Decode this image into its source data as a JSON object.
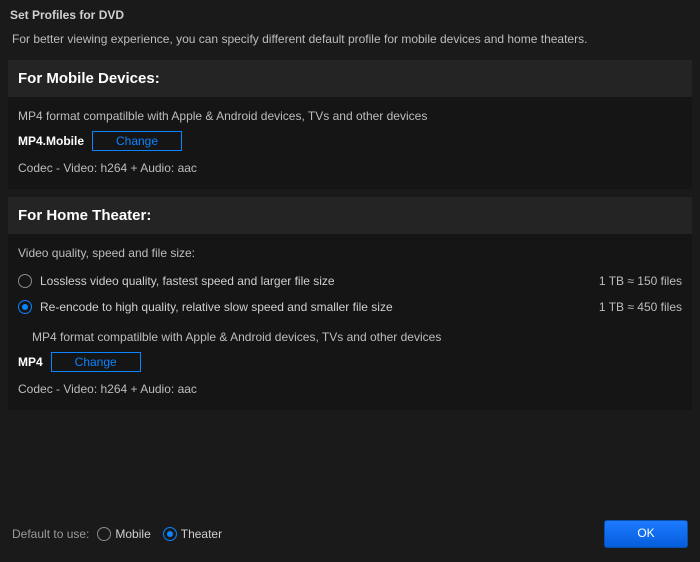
{
  "title": "Set Profiles for DVD",
  "intro": "For better viewing experience, you can specify different default profile for mobile devices and home theaters.",
  "mobile": {
    "header": "For Mobile Devices:",
    "desc": "MP4 format compatilble with Apple & Android devices, TVs and other devices",
    "profile_name": "MP4.Mobile",
    "change_label": "Change",
    "codec": "Codec - Video: h264 + Audio: aac"
  },
  "theater": {
    "header": "For Home Theater:",
    "quality_heading": "Video quality, speed and file size:",
    "options": [
      {
        "label": "Lossless video quality, fastest speed and larger file size",
        "estimate": "1 TB ≈ 150 files",
        "selected": false
      },
      {
        "label": "Re-encode to high quality, relative slow speed and smaller file size",
        "estimate": "1 TB ≈ 450 files",
        "selected": true
      }
    ],
    "desc": "MP4 format compatilble with Apple & Android devices, TVs and other devices",
    "profile_name": "MP4",
    "change_label": "Change",
    "codec": "Codec - Video: h264 + Audio: aac"
  },
  "footer": {
    "default_label": "Default to use:",
    "options": [
      {
        "name": "Mobile",
        "selected": false
      },
      {
        "name": "Theater",
        "selected": true
      }
    ],
    "ok_label": "OK"
  }
}
